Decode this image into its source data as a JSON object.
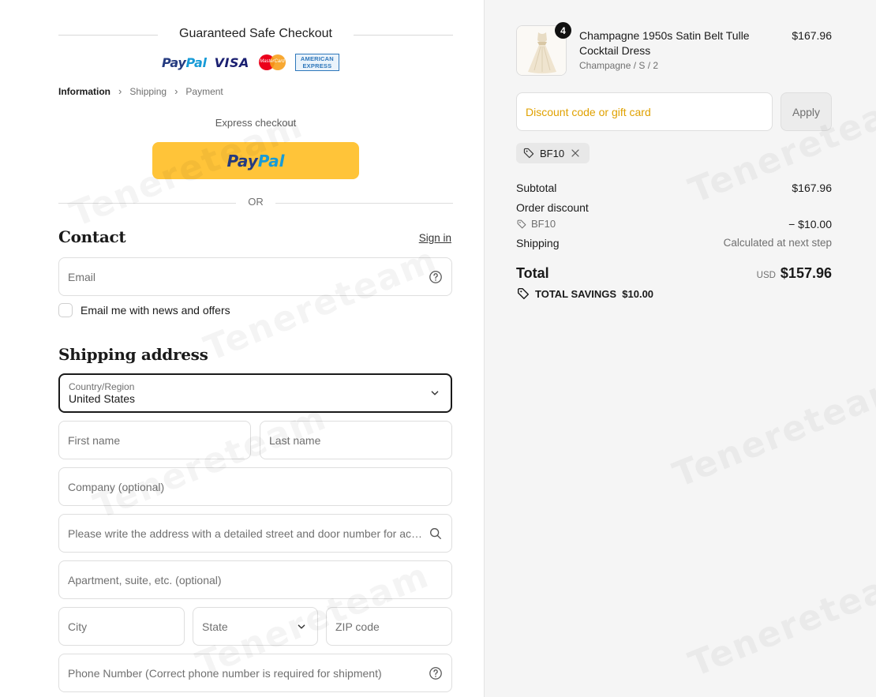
{
  "guarantee": {
    "title": "Guaranteed Safe Checkout",
    "logos": [
      "paypal-logo",
      "visa-logo",
      "mastercard-logo",
      "amex-logo"
    ]
  },
  "logos": {
    "paypal_1": "Pay",
    "paypal_2": "Pal",
    "visa": "VISA",
    "mastercard": "MasterCard",
    "amex_1": "AMERICAN",
    "amex_2": "EXPRESS"
  },
  "breadcrumb": [
    "Information",
    "Shipping",
    "Payment"
  ],
  "express": {
    "label": "Express checkout",
    "paypal_1": "Pay",
    "paypal_2": "Pal",
    "or": "OR"
  },
  "contact": {
    "title": "Contact",
    "signin": "Sign in",
    "email_placeholder": "Email",
    "newsletter_label": "Email me with news and offers"
  },
  "shipping": {
    "title": "Shipping address",
    "country_label": "Country/Region",
    "country_value": "United States",
    "first_name": "First name",
    "last_name": "Last name",
    "company": "Company (optional)",
    "address": "Please write the address with a detailed street and door number for accu...",
    "apartment": "Apartment, suite, etc. (optional)",
    "city": "City",
    "state": "State",
    "zip": "ZIP code",
    "phone": "Phone Number (Correct phone number is required for shipment)"
  },
  "order": {
    "quantity": "4",
    "product_name": "Champagne 1950s Satin Belt Tulle Cocktail Dress",
    "variant": "Champagne / S / 2",
    "price": "$167.96",
    "discount_placeholder": "Discount code or gift card",
    "apply": "Apply",
    "code": "BF10",
    "subtotal_label": "Subtotal",
    "subtotal": "$167.96",
    "order_discount_label": "Order discount",
    "discount_code": "BF10",
    "discount_amount": "− $10.00",
    "shipping_label": "Shipping",
    "shipping_value": "Calculated at next step",
    "total_label": "Total",
    "currency": "USD",
    "total": "$157.96",
    "savings": "TOTAL SAVINGS  $10.00"
  },
  "colors": {
    "paypal_button": "#ffc439",
    "discount_placeholder": "#e0a100",
    "sidebar_bg": "#f5f5f5"
  }
}
